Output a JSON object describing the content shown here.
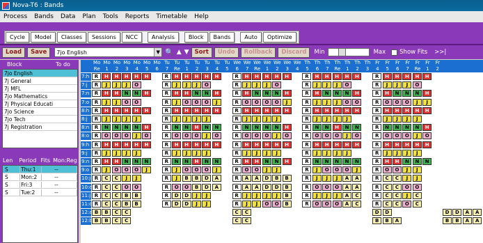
{
  "window": {
    "title": "Nova-T6 : Bands"
  },
  "menu": [
    "Process",
    "Bands",
    "Data",
    "Plan",
    "Tools",
    "Reports",
    "Timetable",
    "Help"
  ],
  "tabs": [
    "Cycle",
    "Model",
    "Classes",
    "Sessions",
    "NCC",
    "Analysis",
    "Block",
    "Bands",
    "Auto",
    "Optimize"
  ],
  "toolbar": {
    "load": "Load",
    "save": "Save",
    "combo": "7jo English",
    "sort": "Sort",
    "undo": "Undo",
    "rollback": "Rollback",
    "discard": "Discard",
    "min": "Min",
    "max": "Max",
    "show_fits": "Show Fits",
    "extra": ">>|"
  },
  "blocks": {
    "col1": "Block",
    "col2": "To do",
    "items": [
      "7jo English",
      "7j General",
      "7j MFL",
      "7jo Mathematics",
      "7j Physical Educati",
      "7jo Science",
      "7jo Tech",
      "7j Registration"
    ]
  },
  "fits": {
    "cols": [
      "Len",
      "Period",
      "Fits",
      "Mon:Reg"
    ],
    "rows": [
      [
        "S",
        "Thu:1",
        "",
        "--"
      ],
      [
        "S",
        "Mon:2",
        "",
        "--"
      ],
      [
        "S",
        "Fri:3",
        "",
        "--"
      ],
      [
        "S",
        "Tue:2",
        "",
        "--"
      ]
    ]
  },
  "grid": {
    "days": [
      "Mo",
      "Mo",
      "Mo",
      "Mo",
      "Mo",
      "Mo",
      "Mo",
      "Tu",
      "Tu",
      "Tu",
      "Tu",
      "Tu",
      "Tu",
      "Tu",
      "We",
      "We",
      "We",
      "We",
      "We",
      "We",
      "We",
      "Th",
      "Th",
      "Th",
      "Th",
      "Th",
      "Th",
      "Th",
      "Fr",
      "Fr",
      "Fr",
      "Fr",
      "Fr",
      "Fr",
      "Fr"
    ],
    "periods": [
      "Re",
      "1",
      "2",
      "3",
      "4",
      "5",
      "6",
      "7",
      "Re",
      "1",
      "2",
      "3",
      "4",
      "5",
      "6",
      "7",
      "Re",
      "1",
      "2",
      "3",
      "4",
      "5",
      "6",
      "7",
      "Re",
      "1",
      "2",
      "3",
      "4",
      "5",
      "6",
      "7",
      "Re",
      "1",
      "2",
      "3",
      "4",
      "5",
      "6"
    ],
    "rows": [
      "7:h",
      "7:j",
      "7:n",
      "7:o",
      "8:h",
      "8:j",
      "8:n",
      "8:o",
      "9:h",
      "9:j",
      "9:n",
      "9:o",
      "10:j",
      "10:o",
      "11:j",
      "11:o",
      "12:a",
      "12:b"
    ],
    "colors": {
      "H": "#e03030",
      "J": "#f0e040",
      "N": "#40b050",
      "O": "#f0b0d0",
      "R": "#ffffff",
      "C": "#f8f0b0",
      "D": "#f8f0b0",
      "B": "#f8f0b0",
      "A": "#f8f0b0",
      "Jb": "#5050c0",
      "K": "#ffe080"
    },
    "data": [
      "RHHHHH.RHHHHH.RHHHHH.RHHHHH.RHHHHH",
      "RJJJO.RJJJO.RJJJO.RJJJO.RJJJO",
      "RHHNNH.RHHNNH.RHNNNH.RHNNNH.RHNNNH",
      "RJJOO.RJOOOJ.ROOOOJ.RJJJOO.ROOOJJ",
      "RHHHHH.RHHHHH.RHHHHH.RHHHHH.RHHHHH",
      "RJJJJ.RJJJJ.RJJJJ.RJJJJ.RJJJJ",
      "RNNNNH.RNNHNN.RNNNNH.RNNHNN.RNNNNH",
      "ROOOJO.ROOOJO.ROOOJO.ROOOJO.ROOOJO",
      "RHHHHH.RHHHHH.RHHHHH.RHHHHH.RHHHHH",
      "RJJJJ.RJJJJ.RJJJJ.RJJJJ.RJJJJ",
      "RHHNNN.RNNHNN.RHHNNH.RNNNNN.RHHNNN",
      "RJOOOJ.RJOOOJ.ROOJJ.RJOOOJ.ROOJJ",
      "RCCJJ.RJBBDA.RAADBB.RJJJAA.RCCJJ",
      "RCCOO.ROOBDA.RAADDB.ROOOAA.RCCOO",
      "RCCBB.RDDJJ.RJJJJB.RJJJAC.RCCJC",
      "RCCBB.RDDJJ.RJJOOB.ROOOAC.RCCOC",
      "BBCC..CC..DD.DDAAA.AABDAA.AACCBA",
      "BBCC..CC..BBA.BBAAAA.AABDDA.AACCBA"
    ]
  }
}
